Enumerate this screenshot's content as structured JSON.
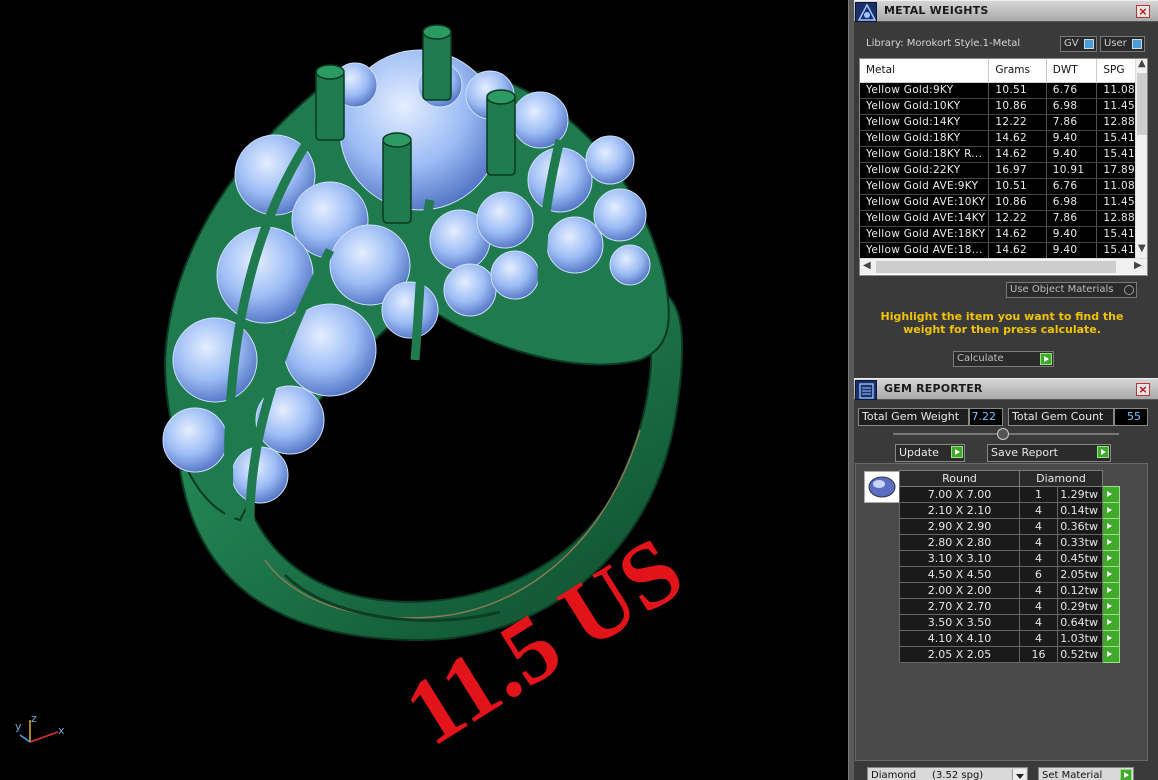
{
  "viewport": {
    "ring_size_text": "11.5 US",
    "axis_labels": {
      "x": "x",
      "y": "y",
      "z": "z"
    }
  },
  "metal_weights": {
    "title": "METAL WEIGHTS",
    "library_label": "Library: Morokort Style.1-Metal",
    "gv_toggle": "GV",
    "user_toggle": "User",
    "columns": [
      "Metal",
      "Grams",
      "DWT",
      "SPG"
    ],
    "rows": [
      [
        "Yellow Gold:9KY",
        "10.51",
        "6.76",
        "11.08"
      ],
      [
        "Yellow Gold:10KY",
        "10.86",
        "6.98",
        "11.45"
      ],
      [
        "Yellow Gold:14KY",
        "12.22",
        "7.86",
        "12.88"
      ],
      [
        "Yellow Gold:18KY",
        "14.62",
        "9.40",
        "15.41"
      ],
      [
        "Yellow Gold:18KY R...",
        "14.62",
        "9.40",
        "15.41"
      ],
      [
        "Yellow Gold:22KY",
        "16.97",
        "10.91",
        "17.89"
      ],
      [
        "Yellow Gold AVE:9KY",
        "10.51",
        "6.76",
        "11.08"
      ],
      [
        "Yellow Gold AVE:10KY",
        "10.86",
        "6.98",
        "11.45"
      ],
      [
        "Yellow Gold AVE:14KY",
        "12.22",
        "7.86",
        "12.88"
      ],
      [
        "Yellow Gold AVE:18KY",
        "14.62",
        "9.40",
        "15.41"
      ],
      [
        "Yellow Gold AVE:18...",
        "14.62",
        "9.40",
        "15.41"
      ]
    ],
    "use_object_materials": "Use Object Materials",
    "hint": "Highlight the item you want to find the weight for then press calculate.",
    "calculate_label": "Calculate"
  },
  "gem_reporter": {
    "title": "GEM REPORTER",
    "total_weight_label": "Total Gem Weight",
    "total_weight_value": "7.22",
    "total_count_label": "Total Gem Count",
    "total_count_value": "55",
    "update_label": "Update",
    "save_report_label": "Save Report",
    "columns": [
      "Round",
      "Diamond"
    ],
    "rows": [
      [
        "7.00 X 7.00",
        "1",
        "1.29tw"
      ],
      [
        "2.10 X 2.10",
        "4",
        "0.14tw"
      ],
      [
        "2.90 X 2.90",
        "4",
        "0.36tw"
      ],
      [
        "2.80 X 2.80",
        "4",
        "0.33tw"
      ],
      [
        "3.10 X 3.10",
        "4",
        "0.45tw"
      ],
      [
        "4.50 X 4.50",
        "6",
        "2.05tw"
      ],
      [
        "2.00 X 2.00",
        "4",
        "0.12tw"
      ],
      [
        "2.70 X 2.70",
        "4",
        "0.29tw"
      ],
      [
        "3.50 X 3.50",
        "4",
        "0.64tw"
      ],
      [
        "4.10 X 4.10",
        "4",
        "1.03tw"
      ],
      [
        "2.05 X 2.05",
        "16",
        "0.52tw"
      ]
    ],
    "material_dropdown": "Diamond     (3.52 spg)",
    "set_material_label": "Set Material"
  },
  "colors": {
    "metal_green": "#1f7a4d",
    "gem_blue": "#8fb4f2",
    "size_text_red": "#e2141a",
    "hint_yellow": "#f0c400",
    "go_green": "#3fa92a"
  }
}
